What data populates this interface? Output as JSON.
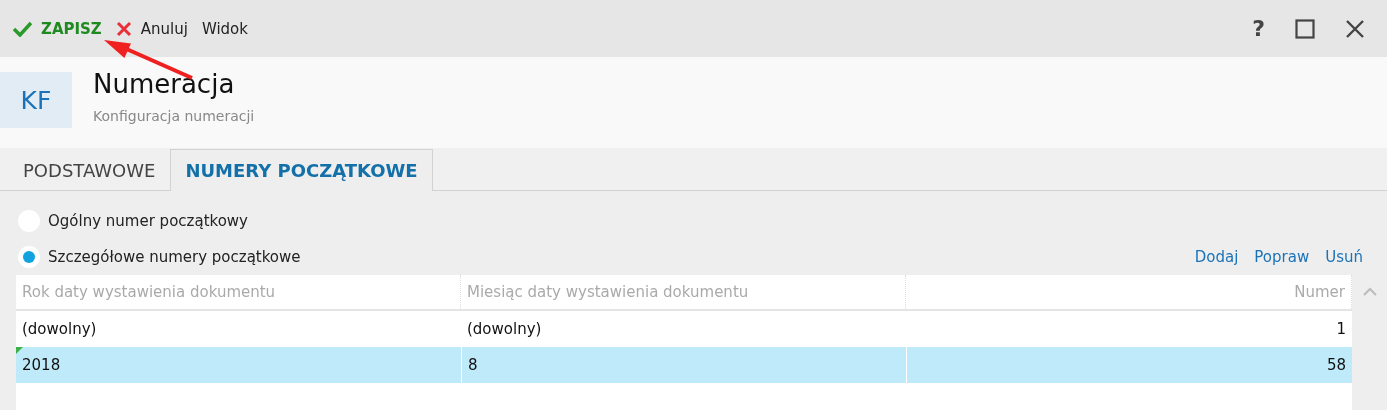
{
  "toolbar": {
    "buttons": [
      {
        "kind": "save",
        "label": "ZAPISZ"
      },
      {
        "kind": "cancel",
        "label": "Anuluj"
      },
      {
        "kind": "plain",
        "label": "Widok"
      }
    ],
    "window_controls": [
      {
        "kind": "help",
        "label": "?"
      },
      {
        "kind": "maximize"
      },
      {
        "kind": "close"
      }
    ]
  },
  "header": {
    "badge": "KF",
    "title": "Numeracja",
    "subtitle": "Konfiguracja numeracji"
  },
  "tabs": [
    {
      "label": "PODSTAWOWE",
      "selected": false
    },
    {
      "label": "NUMERY POCZĄTKOWE",
      "selected": true
    }
  ],
  "options": [
    {
      "label": "Ogólny numer początkowy",
      "selected": false
    },
    {
      "label": "Szczegółowe numery początkowe",
      "selected": true
    }
  ],
  "actions": [
    "Dodaj",
    "Popraw",
    "Usuń"
  ],
  "table": {
    "columns": [
      "Rok daty wystawienia dokumentu",
      "Miesiąc daty wystawienia dokumentu",
      "Numer"
    ],
    "rows": [
      {
        "cells": [
          "(dowolny)",
          "(dowolny)",
          "1"
        ],
        "selected": false,
        "flagged": false
      },
      {
        "cells": [
          "2018",
          "8",
          "58"
        ],
        "selected": true,
        "flagged": true
      }
    ]
  },
  "annotations": [
    {
      "kind": "arrow"
    }
  ]
}
